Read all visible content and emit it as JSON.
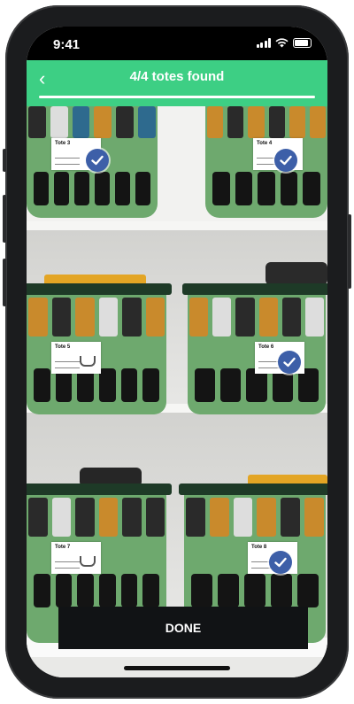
{
  "status_bar": {
    "time": "9:41"
  },
  "header": {
    "title": "4/4 totes found",
    "back_icon": "chevron-left-icon",
    "found": 4,
    "total": 4
  },
  "totes": [
    {
      "label": "Tote 3",
      "checked": true
    },
    {
      "label": "Tote 4",
      "checked": true
    },
    {
      "label": "Tote 5",
      "checked": false
    },
    {
      "label": "Tote 6",
      "checked": true
    },
    {
      "label": "Tote 7",
      "checked": false
    },
    {
      "label": "Tote 8",
      "checked": true
    }
  ],
  "footer": {
    "done_label": "DONE"
  },
  "colors": {
    "accent": "#3dcf84",
    "check": "#3d5fa8",
    "button": "#111315",
    "tote": "#6ea96e"
  }
}
